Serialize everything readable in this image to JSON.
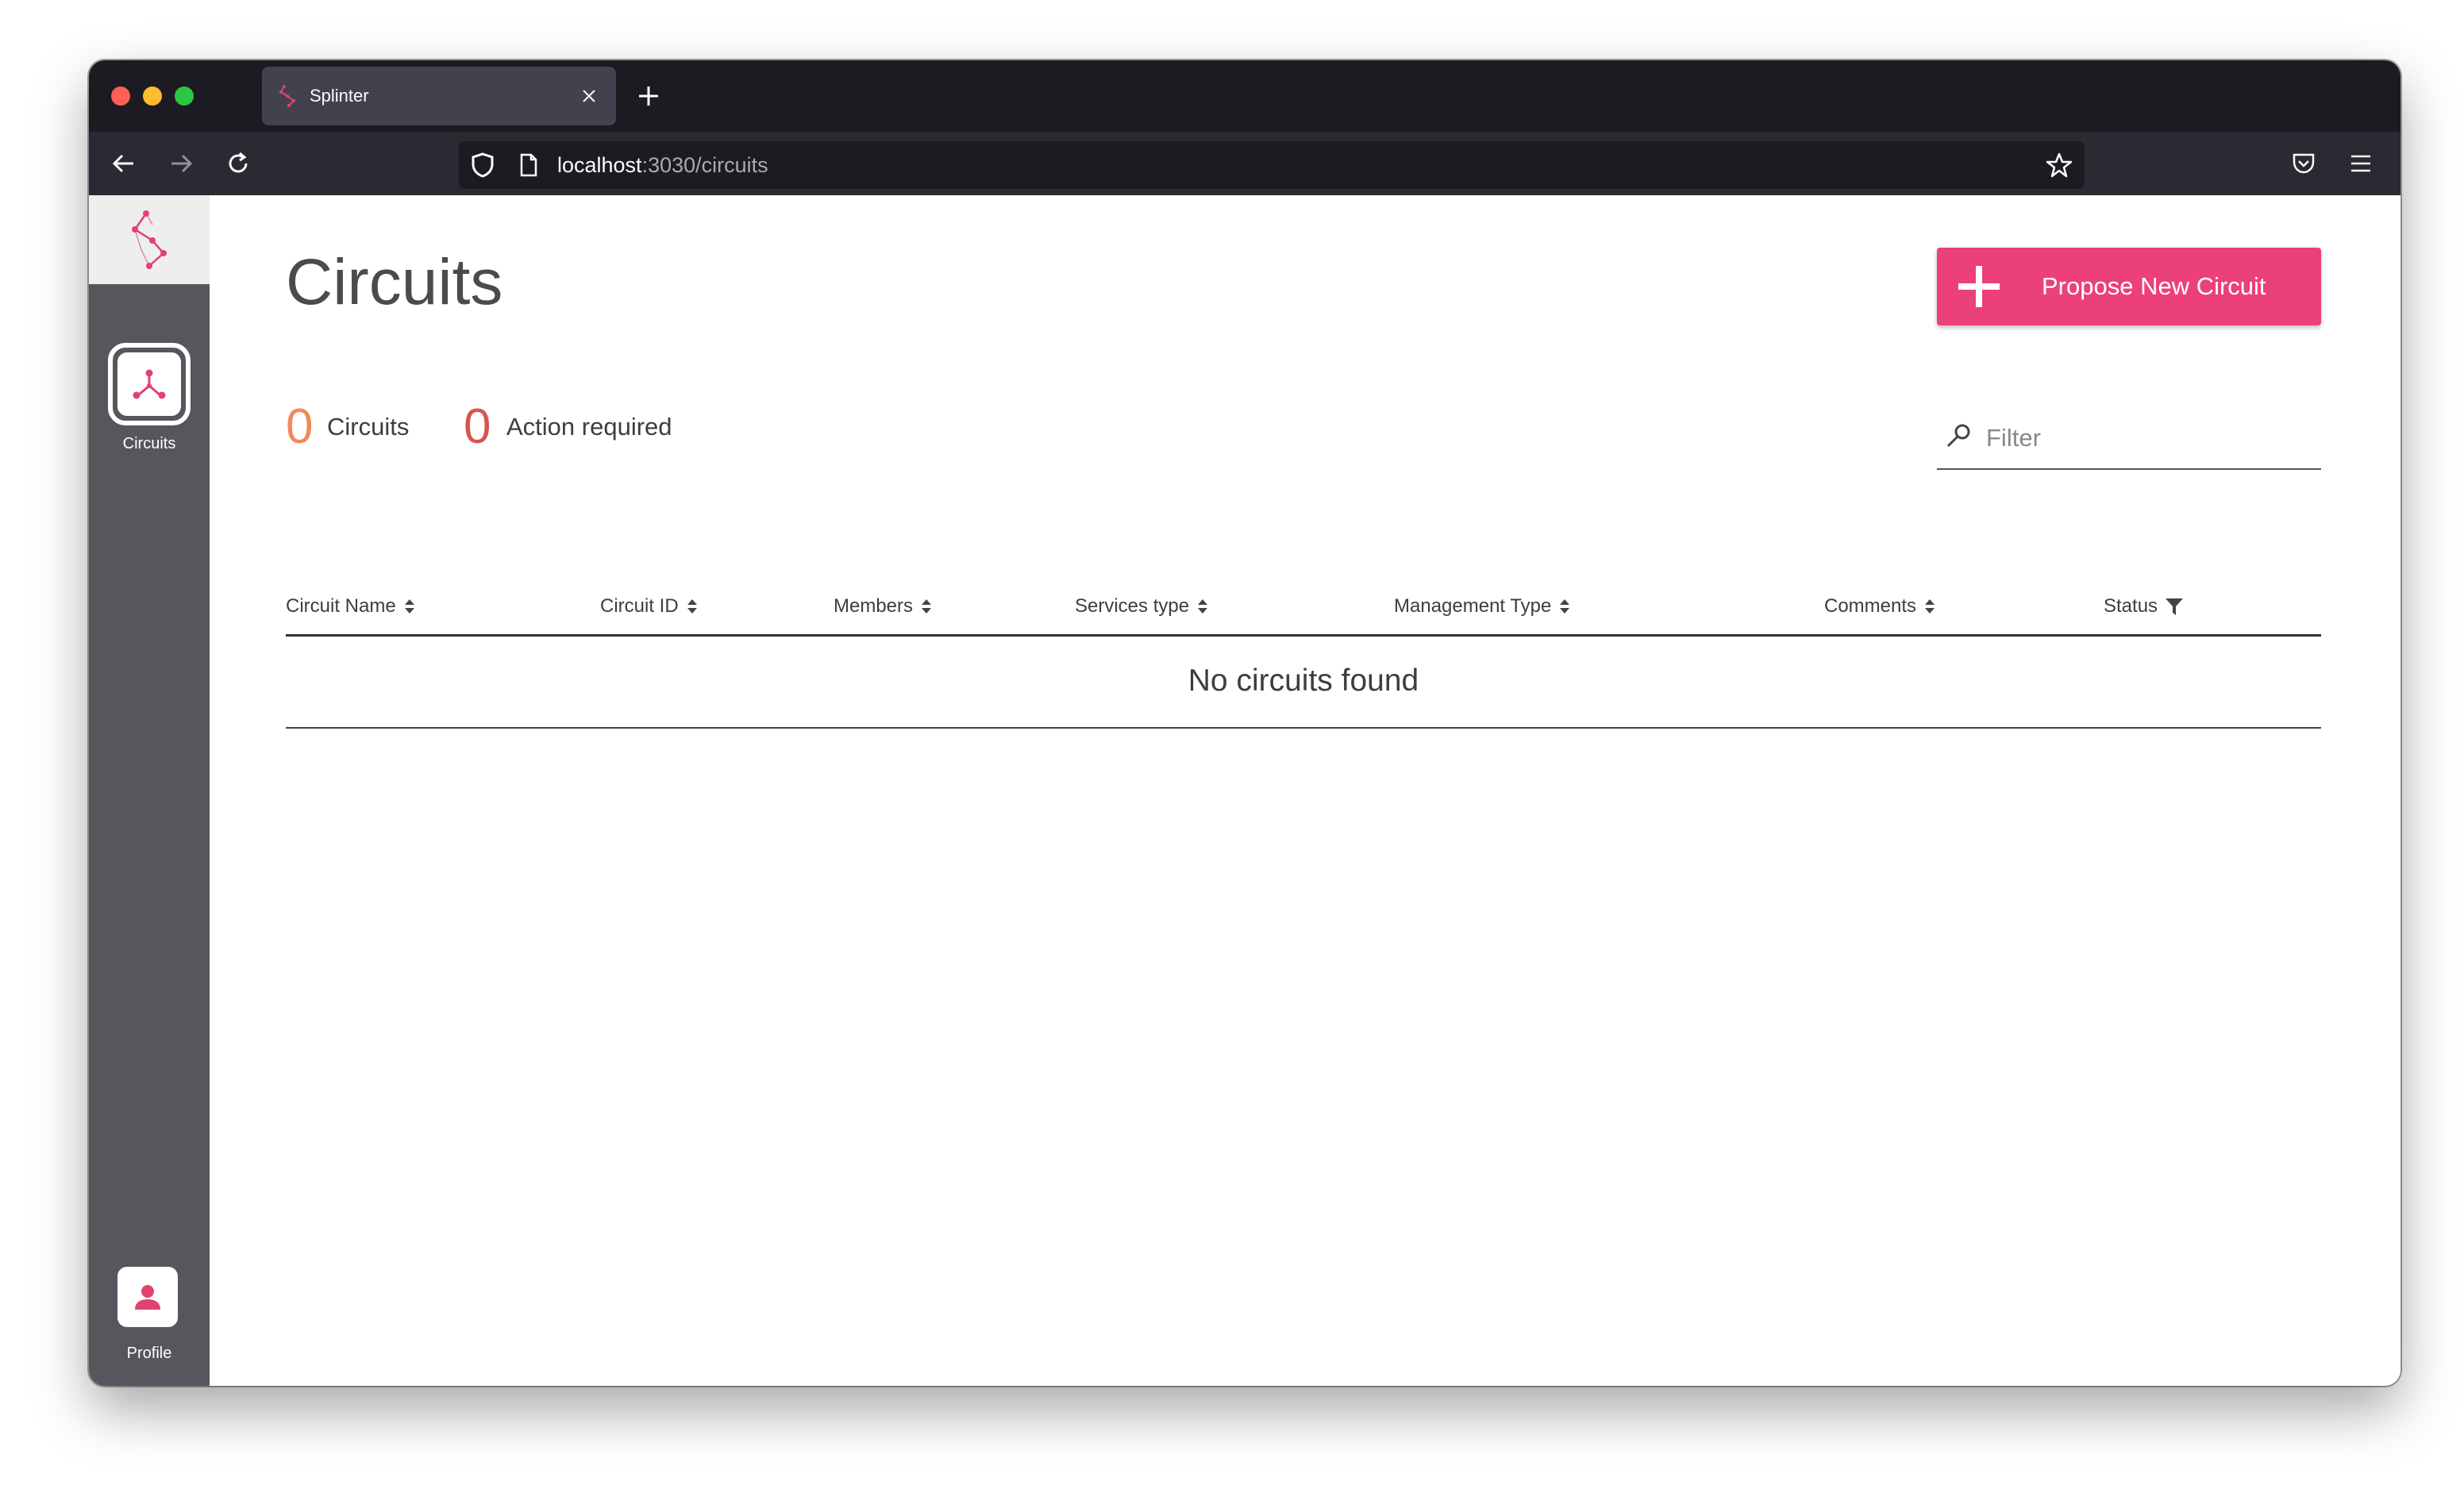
{
  "browser": {
    "tab_title": "Splinter",
    "url_host": "localhost",
    "url_rest": ":3030/circuits"
  },
  "sidebar": {
    "items": [
      {
        "label": "Circuits",
        "icon": "circuits-icon"
      },
      {
        "label": "Profile",
        "icon": "person-icon"
      }
    ]
  },
  "main": {
    "title": "Circuits",
    "propose_button": "Propose New Circuit",
    "stats": [
      {
        "count": "0",
        "label": "Circuits",
        "color": "#f08a5d"
      },
      {
        "count": "0",
        "label": "Action required",
        "color": "#d9534f"
      }
    ],
    "filter_placeholder": "Filter",
    "table": {
      "columns": [
        {
          "label": "Circuit Name",
          "control": "sort"
        },
        {
          "label": "Circuit ID",
          "control": "sort"
        },
        {
          "label": "Members",
          "control": "sort"
        },
        {
          "label": "Services type",
          "control": "sort"
        },
        {
          "label": "Management Type",
          "control": "sort"
        },
        {
          "label": "Comments",
          "control": "sort"
        },
        {
          "label": "Status",
          "control": "filter"
        }
      ],
      "empty_message": "No circuits found"
    }
  },
  "colors": {
    "accent": "#ec407a",
    "sidebar": "#55575d",
    "titlebar": "#1c1b22",
    "navbar": "#2b2a33"
  }
}
